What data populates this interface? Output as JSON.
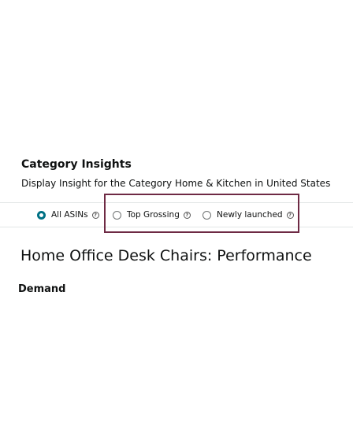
{
  "category_insights": {
    "title": "Category Insights",
    "subtitle": "Display Insight for the Category Home & Kitchen in United States"
  },
  "filters": {
    "selected": "All ASINs",
    "options": [
      {
        "label": "All ASINs",
        "checked": true,
        "help_icon": "help-circle-icon"
      },
      {
        "label": "Top Grossing",
        "checked": false,
        "help_icon": "help-circle-icon"
      },
      {
        "label": "Newly launched",
        "checked": false,
        "help_icon": "help-circle-icon"
      }
    ],
    "help_glyph": "?"
  },
  "performance": {
    "title": "Home Office Desk Chairs: Performance"
  },
  "demand": {
    "label": "Demand"
  },
  "colors": {
    "radio_selected": "#007185",
    "highlight_border": "#6e2a44",
    "divider": "#e3e6e6",
    "text": "#0f1111"
  }
}
